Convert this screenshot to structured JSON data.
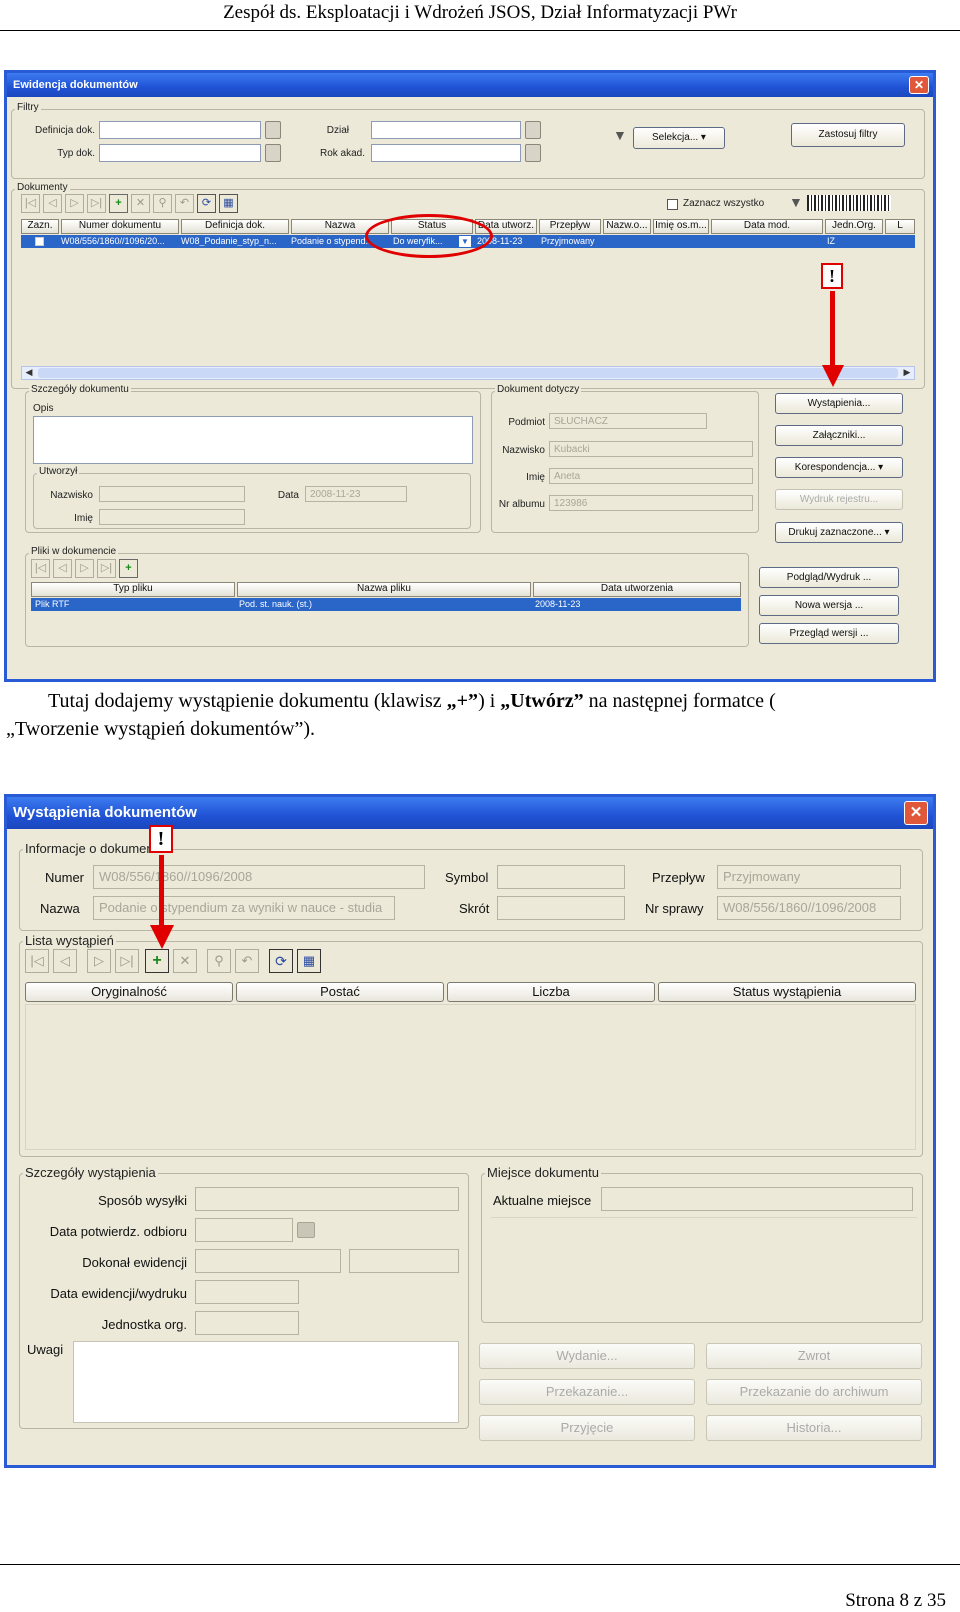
{
  "doc_header": "Zespół ds. Eksploatacji i Wdrożeń JSOS, Dział Informatyzacji PWr",
  "window1": {
    "title": "Ewidencja dokumentów",
    "filters": {
      "group_label": "Filtry",
      "definicja_label": "Definicja dok.",
      "typ_label": "Typ dok.",
      "dzial_label": "Dział",
      "rok_label": "Rok akad.",
      "selekcja_button": "Selekcja...",
      "apply_button": "Zastosuj filtry"
    },
    "documents": {
      "group_label": "Dokumenty",
      "select_all": "Zaznacz wszystko",
      "columns": [
        "Zazn.",
        "Numer dokumentu",
        "Definicja dok.",
        "Nazwa",
        "Status",
        "Data utworz.",
        "Przepływ",
        "Nazw.o...",
        "Imię os.m...",
        "Data mod.",
        "Jedn.Org.",
        "L"
      ],
      "rows": [
        {
          "numer": "W08/556/1860//1096/20...",
          "definicja": "W08_Podanie_styp_n...",
          "nazwa": "Podanie o stypend...",
          "status": "Do weryfik...",
          "data": "2008-11-23",
          "przeplyw": "Przyjmowany",
          "jedn": "IZ"
        }
      ]
    },
    "details": {
      "group_label": "Szczegóły dokumentu",
      "opis_label": "Opis",
      "utworzyl_label": "Utworzył",
      "nazwisko_label": "Nazwisko",
      "imie_label": "Imię",
      "data_label": "Data",
      "data_value": "2008-11-23"
    },
    "subject": {
      "group_label": "Dokument dotyczy",
      "podmiot_label": "Podmiot",
      "podmiot_value": "SŁUCHACZ",
      "nazwisko_label": "Nazwisko",
      "nazwisko_value": "Kubacki",
      "imie_label": "Imię",
      "imie_value": "Aneta",
      "album_label": "Nr albumu",
      "album_value": "123986"
    },
    "side_buttons": [
      "Wystąpienia...",
      "Załączniki...",
      "Korespondencja...",
      "Wydruk rejestru...",
      "Drukuj zaznaczone..."
    ],
    "files": {
      "group_label": "Pliki w dokumencie",
      "columns": [
        "Typ pliku",
        "Nazwa pliku",
        "Data utworzenia"
      ],
      "row": {
        "typ": "Plik RTF",
        "nazwa": "Pod. st. nauk. (st.)",
        "data": "2008-11-23"
      }
    },
    "file_buttons": [
      "Podgląd/Wydruk ...",
      "Nowa wersja ...",
      "Przegląd wersji ..."
    ],
    "exclamation": "!"
  },
  "instruction": {
    "part1": "Tutaj dodajemy wystąpienie dokumentu (klawisz ",
    "plus": "„+”",
    "part2": ") i ",
    "utworz": "„Utwórz”",
    "part3": " na następnej formatce (",
    "part4": "„Tworzenie wystąpień dokumentów”)."
  },
  "window2": {
    "title": "Wystąpienia dokumentów",
    "info": {
      "group_label": "Informacje o dokumencie",
      "numer_label": "Numer",
      "numer_value": "W08/556/1860//1096/2008",
      "nazwa_label": "Nazwa",
      "nazwa_value": "Podanie o stypendium za wyniki w nauce - studia",
      "symbol_label": "Symbol",
      "skrot_label": "Skrót",
      "przeplyw_label": "Przepływ",
      "przeplyw_value": "Przyjmowany",
      "sprawa_label": "Nr sprawy",
      "sprawa_value": "W08/556/1860//1096/2008"
    },
    "list": {
      "group_label": "Lista wystąpień",
      "columns": [
        "Oryginalność",
        "Postać",
        "Liczba",
        "Status wystąpienia"
      ]
    },
    "details": {
      "group_label": "Szczegóły wystąpienia",
      "sposob": "Sposób wysyłki",
      "data_potw": "Data potwierdz. odbioru",
      "dokonal": "Dokonał ewidencji",
      "data_ewid": "Data ewidencji/wydruku",
      "jednostka": "Jednostka org.",
      "uwagi": "Uwagi"
    },
    "place": {
      "group_label": "Miejsce dokumentu",
      "aktualne": "Aktualne miejsce"
    },
    "buttons": [
      "Wydanie...",
      "Zwrot",
      "Przekazanie...",
      "Przekazanie do archiwum",
      "Przyjęcie",
      "Historia..."
    ],
    "exclamation": "!"
  },
  "footer": "Strona 8 z 35"
}
